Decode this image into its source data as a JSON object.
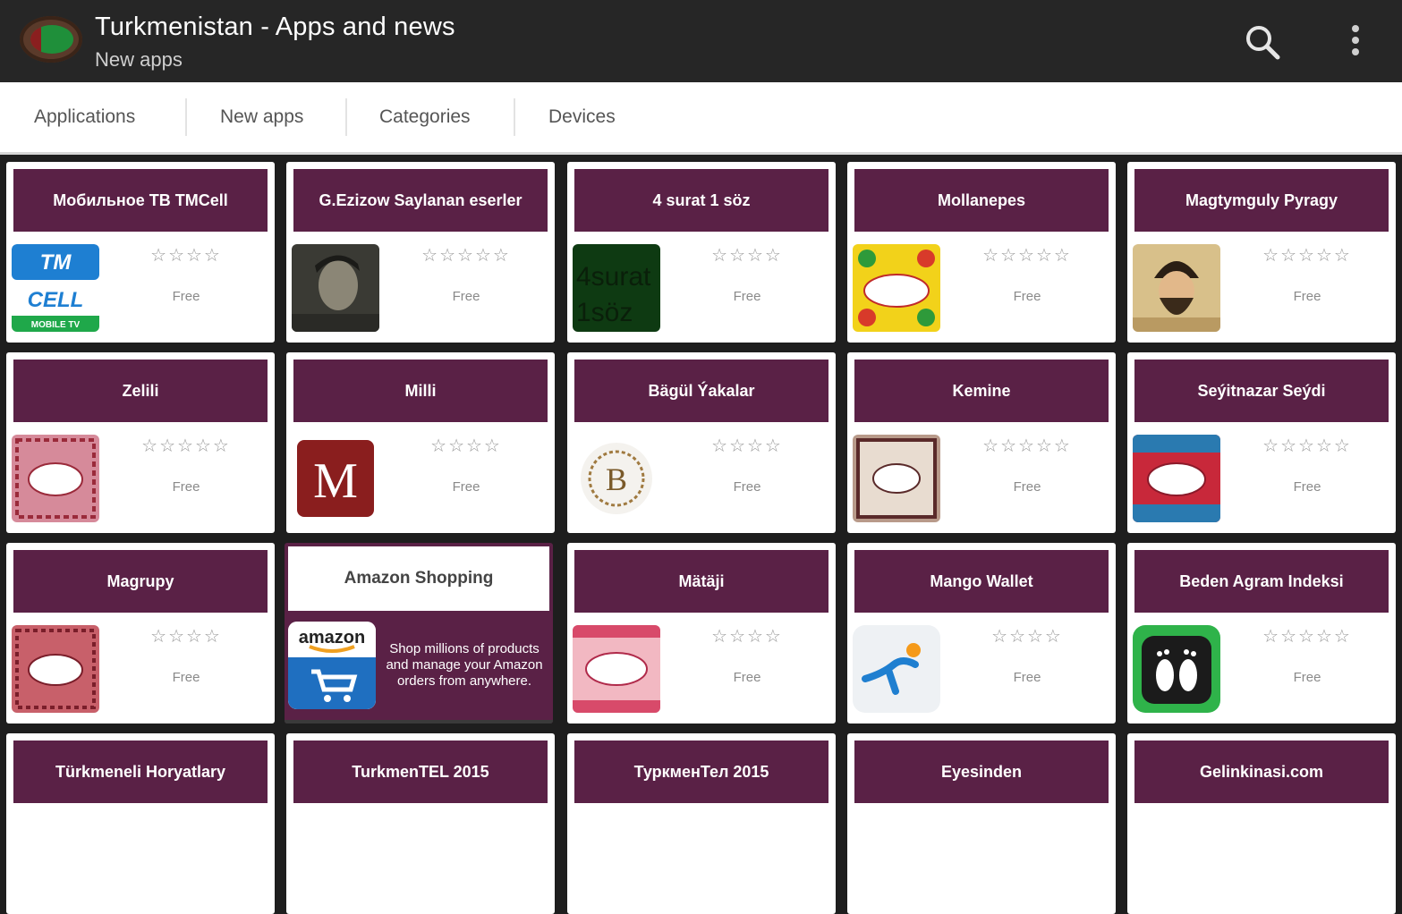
{
  "appbar": {
    "title": "Turkmenistan - Apps and news",
    "subtitle": "New apps",
    "search_icon": "search-icon",
    "menu_icon": "overflow-menu-icon",
    "color": "#262626"
  },
  "tabs": [
    {
      "label": "Applications"
    },
    {
      "label": "New apps"
    },
    {
      "label": "Categories"
    },
    {
      "label": "Devices"
    }
  ],
  "accent_color": "#5a2146",
  "cards": [
    {
      "title": "Мобильное ТВ TMCell",
      "stars": "☆☆☆☆",
      "price": "Free"
    },
    {
      "title": "G.Ezizow Saylanan eserler",
      "stars": "☆☆☆☆☆",
      "price": "Free"
    },
    {
      "title": "4 surat 1 söz",
      "stars": "☆☆☆☆",
      "price": "Free"
    },
    {
      "title": "Mollanepes",
      "stars": "☆☆☆☆☆",
      "price": "Free"
    },
    {
      "title": "Magtymguly Pyragy",
      "stars": "☆☆☆☆☆",
      "price": "Free"
    },
    {
      "title": "Zelili",
      "stars": "☆☆☆☆☆",
      "price": "Free"
    },
    {
      "title": "Milli",
      "stars": "☆☆☆☆",
      "price": "Free"
    },
    {
      "title": "Bägül Ýakalar",
      "stars": "☆☆☆☆",
      "price": "Free"
    },
    {
      "title": "Kemine",
      "stars": "☆☆☆☆☆",
      "price": "Free"
    },
    {
      "title": "Seýitnazar Seýdi",
      "stars": "☆☆☆☆☆",
      "price": "Free"
    },
    {
      "title": "Magrupy",
      "stars": "☆☆☆☆",
      "price": "Free"
    },
    {
      "title": "Amazon Shopping",
      "ad_text": "Shop millions of products and manage your Amazon orders from anywhere.",
      "logo_text": "amazon"
    },
    {
      "title": "Mätäji",
      "stars": "☆☆☆☆",
      "price": "Free"
    },
    {
      "title": "Mango Wallet",
      "stars": "☆☆☆☆",
      "price": "Free"
    },
    {
      "title": "Beden Agram Indeksi",
      "stars": "☆☆☆☆☆",
      "price": "Free"
    },
    {
      "title": "Türkmeneli Horyatlary"
    },
    {
      "title": "TurkmenTEL 2015"
    },
    {
      "title": "ТуркменТел 2015"
    },
    {
      "title": "Eyesinden"
    },
    {
      "title": "Gelinkinasi.com"
    }
  ],
  "icons": {
    "tmcell": {
      "top": "TM",
      "bottom": "CELL",
      "small": "MOBILE TV"
    },
    "foursurat": {
      "line1": "4surat",
      "line2": "1söz"
    },
    "milli": "M",
    "bagul": "B"
  }
}
